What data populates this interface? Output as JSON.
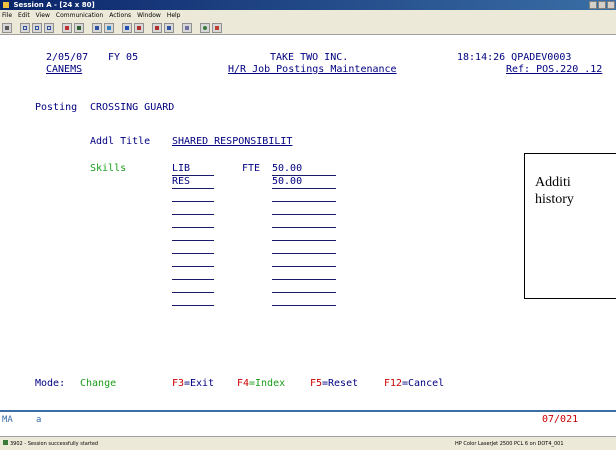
{
  "window": {
    "title": "Session A - [24 x 80]"
  },
  "menu": [
    "File",
    "Edit",
    "View",
    "Communication",
    "Actions",
    "Window",
    "Help"
  ],
  "header": {
    "date": "2/05/07",
    "fy": "FY 05",
    "company": "TAKE TWO INC.",
    "time_job": "18:14:26 QPADEV0003",
    "program": "CANEMS",
    "screen_title": "H/R Job Postings Maintenance",
    "ref": "Ref: POS.220 .12"
  },
  "posting": {
    "label": "Posting",
    "value": "CROSSING GUARD"
  },
  "addl_title": {
    "label": "Addl Title",
    "value": "SHARED RESPONSIBILIT"
  },
  "skills": {
    "label": "Skills",
    "fte_label": "FTE",
    "rows": [
      {
        "skill": "LIB",
        "fte": "50.00"
      },
      {
        "skill": "RES",
        "fte": "50.00"
      },
      {
        "skill": "",
        "fte": ""
      },
      {
        "skill": "",
        "fte": ""
      },
      {
        "skill": "",
        "fte": ""
      },
      {
        "skill": "",
        "fte": ""
      },
      {
        "skill": "",
        "fte": ""
      },
      {
        "skill": "",
        "fte": ""
      },
      {
        "skill": "",
        "fte": ""
      },
      {
        "skill": "",
        "fte": ""
      }
    ]
  },
  "callout": {
    "line1": "Additi",
    "line2": "history"
  },
  "footer": {
    "mode_label": "Mode:",
    "mode_value": "Change",
    "f3_key": "F3",
    "f3_text": "=Exit",
    "f4_key": "F4",
    "f4_text": "=Index",
    "f5_key": "F5",
    "f5_text": "=Reset",
    "f12_key": "F12",
    "f12_text": "=Cancel"
  },
  "oia": {
    "mode": "MA",
    "indicator": "a",
    "cursor": "07/021"
  },
  "status": {
    "left": "3902 - Session successfully started",
    "right": "HP Color LaserJet 2500 PCL 6 on DOT4_001"
  },
  "colors": {
    "field_text": "#000080",
    "label_green": "#1a9f1a",
    "key_red": "#cc0000",
    "oia_red": "#cc0000"
  }
}
